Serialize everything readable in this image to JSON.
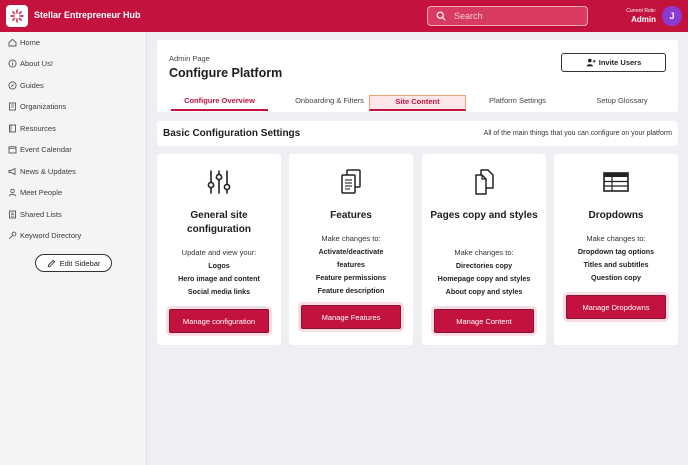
{
  "header": {
    "brand": "Stellar Entrepreneur Hub",
    "search_placeholder": "Search",
    "role_label": "Current Role:",
    "role_value": "Admin",
    "avatar_initial": "J",
    "accent_color": "#c4123f"
  },
  "sidebar": {
    "items": [
      {
        "label": "Home",
        "icon": "home-icon"
      },
      {
        "label": "About Us!",
        "icon": "info-icon"
      },
      {
        "label": "Guides",
        "icon": "compass-icon"
      },
      {
        "label": "Organizations",
        "icon": "building-icon"
      },
      {
        "label": "Resources",
        "icon": "book-icon"
      },
      {
        "label": "Event Calendar",
        "icon": "calendar-icon"
      },
      {
        "label": "News & Updates",
        "icon": "megaphone-icon"
      },
      {
        "label": "Meet People",
        "icon": "person-icon"
      },
      {
        "label": "Shared Lists",
        "icon": "list-icon"
      },
      {
        "label": "Keyword Directory",
        "icon": "key-icon"
      }
    ],
    "edit_label": "Edit Sidebar"
  },
  "page": {
    "breadcrumb": "Admin Page",
    "title": "Configure Platform",
    "invite_label": "Invite Users",
    "tabs": [
      {
        "label": "Configure Overview"
      },
      {
        "label": "Onboarding & Filters"
      },
      {
        "label": "Site Content"
      },
      {
        "label": "Platform Settings"
      },
      {
        "label": "Setup Glossary"
      }
    ]
  },
  "config": {
    "title": "Basic Configuration Settings",
    "subtitle": "All of the main things that you can configure on your platform"
  },
  "cards": [
    {
      "title": "General site configuration",
      "intro": "Update and view your:",
      "items": [
        "Logos",
        "Hero image and content",
        "Social media links"
      ],
      "button": "Manage configuration",
      "icon": "sliders-icon"
    },
    {
      "title": "Features",
      "intro": "Make changes to:",
      "items": [
        "Activate/deactivate features",
        "Feature permissions",
        "Feature description"
      ],
      "button": "Manage Features",
      "icon": "documents-icon"
    },
    {
      "title": "Pages copy and styles",
      "intro": "Make changes to:",
      "items": [
        "Directories copy",
        "Homepage copy and styles",
        "About copy and styles"
      ],
      "button": "Manage Content",
      "icon": "pages-icon"
    },
    {
      "title": "Dropdowns",
      "intro": "Make changes to:",
      "items": [
        "Dropdown tag options",
        "Titles and subtitles",
        "Question copy"
      ],
      "button": "Manage Dropdowns",
      "icon": "table-icon"
    }
  ]
}
